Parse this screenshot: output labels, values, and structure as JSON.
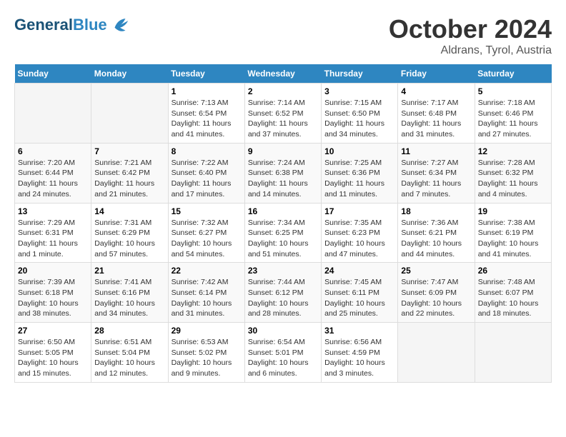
{
  "header": {
    "logo_line1": "General",
    "logo_line2": "Blue",
    "title": "October 2024",
    "subtitle": "Aldrans, Tyrol, Austria"
  },
  "weekdays": [
    "Sunday",
    "Monday",
    "Tuesday",
    "Wednesday",
    "Thursday",
    "Friday",
    "Saturday"
  ],
  "weeks": [
    [
      {
        "day": "",
        "info": ""
      },
      {
        "day": "",
        "info": ""
      },
      {
        "day": "1",
        "info": "Sunrise: 7:13 AM\nSunset: 6:54 PM\nDaylight: 11 hours and 41 minutes."
      },
      {
        "day": "2",
        "info": "Sunrise: 7:14 AM\nSunset: 6:52 PM\nDaylight: 11 hours and 37 minutes."
      },
      {
        "day": "3",
        "info": "Sunrise: 7:15 AM\nSunset: 6:50 PM\nDaylight: 11 hours and 34 minutes."
      },
      {
        "day": "4",
        "info": "Sunrise: 7:17 AM\nSunset: 6:48 PM\nDaylight: 11 hours and 31 minutes."
      },
      {
        "day": "5",
        "info": "Sunrise: 7:18 AM\nSunset: 6:46 PM\nDaylight: 11 hours and 27 minutes."
      }
    ],
    [
      {
        "day": "6",
        "info": "Sunrise: 7:20 AM\nSunset: 6:44 PM\nDaylight: 11 hours and 24 minutes."
      },
      {
        "day": "7",
        "info": "Sunrise: 7:21 AM\nSunset: 6:42 PM\nDaylight: 11 hours and 21 minutes."
      },
      {
        "day": "8",
        "info": "Sunrise: 7:22 AM\nSunset: 6:40 PM\nDaylight: 11 hours and 17 minutes."
      },
      {
        "day": "9",
        "info": "Sunrise: 7:24 AM\nSunset: 6:38 PM\nDaylight: 11 hours and 14 minutes."
      },
      {
        "day": "10",
        "info": "Sunrise: 7:25 AM\nSunset: 6:36 PM\nDaylight: 11 hours and 11 minutes."
      },
      {
        "day": "11",
        "info": "Sunrise: 7:27 AM\nSunset: 6:34 PM\nDaylight: 11 hours and 7 minutes."
      },
      {
        "day": "12",
        "info": "Sunrise: 7:28 AM\nSunset: 6:32 PM\nDaylight: 11 hours and 4 minutes."
      }
    ],
    [
      {
        "day": "13",
        "info": "Sunrise: 7:29 AM\nSunset: 6:31 PM\nDaylight: 11 hours and 1 minute."
      },
      {
        "day": "14",
        "info": "Sunrise: 7:31 AM\nSunset: 6:29 PM\nDaylight: 10 hours and 57 minutes."
      },
      {
        "day": "15",
        "info": "Sunrise: 7:32 AM\nSunset: 6:27 PM\nDaylight: 10 hours and 54 minutes."
      },
      {
        "day": "16",
        "info": "Sunrise: 7:34 AM\nSunset: 6:25 PM\nDaylight: 10 hours and 51 minutes."
      },
      {
        "day": "17",
        "info": "Sunrise: 7:35 AM\nSunset: 6:23 PM\nDaylight: 10 hours and 47 minutes."
      },
      {
        "day": "18",
        "info": "Sunrise: 7:36 AM\nSunset: 6:21 PM\nDaylight: 10 hours and 44 minutes."
      },
      {
        "day": "19",
        "info": "Sunrise: 7:38 AM\nSunset: 6:19 PM\nDaylight: 10 hours and 41 minutes."
      }
    ],
    [
      {
        "day": "20",
        "info": "Sunrise: 7:39 AM\nSunset: 6:18 PM\nDaylight: 10 hours and 38 minutes."
      },
      {
        "day": "21",
        "info": "Sunrise: 7:41 AM\nSunset: 6:16 PM\nDaylight: 10 hours and 34 minutes."
      },
      {
        "day": "22",
        "info": "Sunrise: 7:42 AM\nSunset: 6:14 PM\nDaylight: 10 hours and 31 minutes."
      },
      {
        "day": "23",
        "info": "Sunrise: 7:44 AM\nSunset: 6:12 PM\nDaylight: 10 hours and 28 minutes."
      },
      {
        "day": "24",
        "info": "Sunrise: 7:45 AM\nSunset: 6:11 PM\nDaylight: 10 hours and 25 minutes."
      },
      {
        "day": "25",
        "info": "Sunrise: 7:47 AM\nSunset: 6:09 PM\nDaylight: 10 hours and 22 minutes."
      },
      {
        "day": "26",
        "info": "Sunrise: 7:48 AM\nSunset: 6:07 PM\nDaylight: 10 hours and 18 minutes."
      }
    ],
    [
      {
        "day": "27",
        "info": "Sunrise: 6:50 AM\nSunset: 5:05 PM\nDaylight: 10 hours and 15 minutes."
      },
      {
        "day": "28",
        "info": "Sunrise: 6:51 AM\nSunset: 5:04 PM\nDaylight: 10 hours and 12 minutes."
      },
      {
        "day": "29",
        "info": "Sunrise: 6:53 AM\nSunset: 5:02 PM\nDaylight: 10 hours and 9 minutes."
      },
      {
        "day": "30",
        "info": "Sunrise: 6:54 AM\nSunset: 5:01 PM\nDaylight: 10 hours and 6 minutes."
      },
      {
        "day": "31",
        "info": "Sunrise: 6:56 AM\nSunset: 4:59 PM\nDaylight: 10 hours and 3 minutes."
      },
      {
        "day": "",
        "info": ""
      },
      {
        "day": "",
        "info": ""
      }
    ]
  ]
}
